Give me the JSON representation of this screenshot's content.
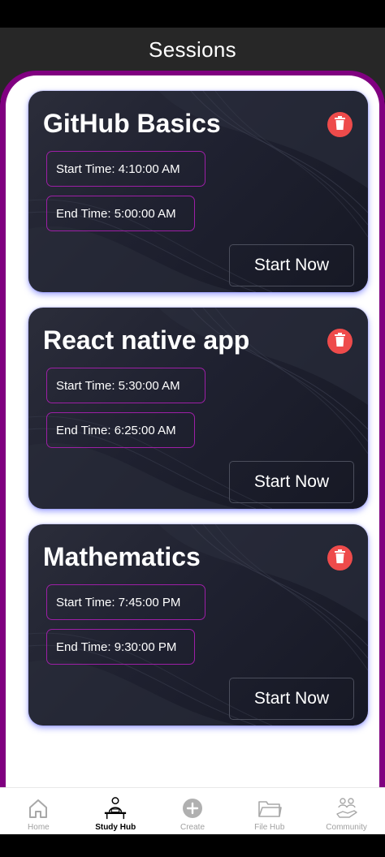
{
  "header": {
    "title": "Sessions"
  },
  "sessions": [
    {
      "title": "GitHub Basics",
      "start_time": "Start Time: 4:10:00 AM",
      "end_time": "End Time: 5:00:00 AM",
      "action_label": "Start Now"
    },
    {
      "title": "React native app",
      "start_time": "Start Time: 5:30:00 AM",
      "end_time": "End Time: 6:25:00 AM",
      "action_label": "Start Now"
    },
    {
      "title": "Mathematics",
      "start_time": "Start Time: 7:45:00 PM",
      "end_time": "End Time: 9:30:00 PM",
      "action_label": "Start Now"
    }
  ],
  "nav": {
    "items": [
      {
        "label": "Home",
        "icon": "home-icon",
        "active": false
      },
      {
        "label": "Study Hub",
        "icon": "study-desk-icon",
        "active": true
      },
      {
        "label": "Create",
        "icon": "plus-circle-icon",
        "active": false
      },
      {
        "label": "File Hub",
        "icon": "folder-icon",
        "active": false
      },
      {
        "label": "Community",
        "icon": "community-icon",
        "active": false
      }
    ]
  },
  "colors": {
    "header_bg": "#272727",
    "sheet_border": "#800080",
    "card_bg": "#1f2130",
    "pill_border": "#9d1fa6",
    "delete_bg": "#ee4b4b",
    "card_glow": "#5a5aff"
  }
}
